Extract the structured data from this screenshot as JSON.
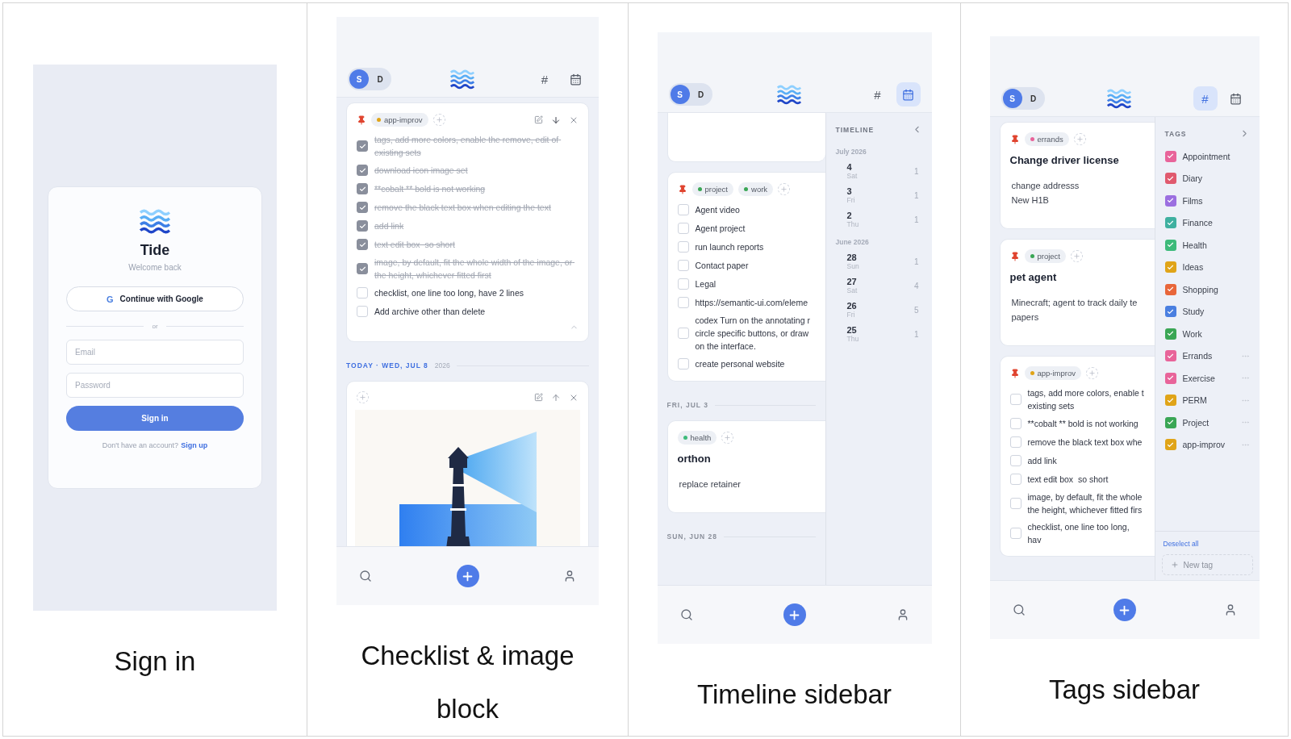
{
  "columns": [
    {
      "caption": "Sign in",
      "screen": {
        "kind": "signin",
        "app_name": "Tide",
        "subtitle": "Welcome back",
        "google_button": {
          "icon": "G",
          "label": "Continue with Google"
        },
        "divider": "or",
        "fields": [
          {
            "placeholder": "Email"
          },
          {
            "placeholder": "Password"
          }
        ],
        "submit": "Sign in",
        "footer": {
          "text": "Don't have an account?",
          "link": "Sign up"
        }
      }
    },
    {
      "caption": "Checklist & image block",
      "screen": {
        "kind": "feed",
        "header": {
          "workspaces": [
            {
              "label": "S",
              "selected": true
            },
            {
              "label": "D",
              "selected": false
            }
          ],
          "tags_button": {
            "label": "#",
            "selected": false
          },
          "timeline_button": {
            "selected": false
          }
        },
        "blocks": [
          {
            "kind": "card",
            "pinned": true,
            "tags": [
              {
                "label": "app-improv",
                "color": "#e0a418"
              }
            ],
            "toolbar": {
              "kind": "down"
            },
            "collapse": true,
            "items": [
              {
                "text": "tags, add more colors, enable the remove, edit of existing sets",
                "checked": true
              },
              {
                "text": "download icon image set",
                "checked": true
              },
              {
                "text": "**cobalt ** bold is not working",
                "checked": true
              },
              {
                "text": "remove the black text box when editing the text",
                "checked": true
              },
              {
                "text": "add link",
                "checked": true
              },
              {
                "text": "text edit box  so short",
                "checked": true
              },
              {
                "text": "image, by default, fit the whole width of the image, or the height, whichever fitted first",
                "checked": true
              },
              {
                "text": "checklist, one line too long, have 2 lines",
                "checked": false
              },
              {
                "text": "Add archive other than delete",
                "checked": false
              }
            ]
          },
          {
            "kind": "date",
            "label": "TODAY · WED, JUL 8",
            "year": "2026",
            "highlight": true
          },
          {
            "kind": "image_card",
            "pinned": false,
            "toolbar": {
              "kind": "up"
            }
          }
        ]
      }
    },
    {
      "caption": "Timeline sidebar",
      "screen": {
        "kind": "feed",
        "header": {
          "workspaces": [
            {
              "label": "S",
              "selected": true
            },
            {
              "label": "D",
              "selected": false
            }
          ],
          "tags_button": {
            "label": "#",
            "selected": false
          },
          "timeline_button": {
            "selected": true
          }
        },
        "blocks": [
          {
            "kind": "card"
          },
          {
            "kind": "card",
            "pinned": true,
            "tags": [
              {
                "label": "project",
                "color": "#3aa655"
              },
              {
                "label": "work",
                "color": "#3aa655"
              }
            ],
            "items": [
              {
                "text": "Agent video",
                "checked": false
              },
              {
                "text": "Agent project",
                "checked": false
              },
              {
                "text": "run launch reports",
                "checked": false
              },
              {
                "text": "Contact paper",
                "checked": false
              },
              {
                "text": "Legal",
                "checked": false
              },
              {
                "text": "https://semantic-ui.com/eleme",
                "checked": false
              },
              {
                "text": "codex Turn on the annotating r\ncircle specific buttons, or draw\non the interface.",
                "checked": false
              },
              {
                "text": "create personal website",
                "checked": false
              }
            ]
          },
          {
            "kind": "date",
            "label": "FRI, JUL 3",
            "highlight": false
          },
          {
            "kind": "card",
            "pinned": false,
            "tags": [
              {
                "label": "health",
                "color": "#3dba7a"
              }
            ],
            "title": "orthon",
            "body": [
              "replace retainer"
            ]
          },
          {
            "kind": "date",
            "label": "SUN, JUN 28",
            "highlight": false
          }
        ],
        "sidebar": {
          "kind": "timeline",
          "title": "TIMELINE",
          "groups": [
            {
              "month": "July 2026",
              "days": [
                {
                  "day": "4",
                  "weekday": "Sat",
                  "count": "1"
                },
                {
                  "day": "3",
                  "weekday": "Fri",
                  "count": "1"
                },
                {
                  "day": "2",
                  "weekday": "Thu",
                  "count": "1"
                }
              ]
            },
            {
              "month": "June 2026",
              "days": [
                {
                  "day": "28",
                  "weekday": "Sun",
                  "count": "1"
                },
                {
                  "day": "27",
                  "weekday": "Sat",
                  "count": "4"
                },
                {
                  "day": "26",
                  "weekday": "Fri",
                  "count": "5"
                },
                {
                  "day": "25",
                  "weekday": "Thu",
                  "count": "1"
                }
              ]
            }
          ]
        }
      }
    },
    {
      "caption": "Tags sidebar",
      "screen": {
        "kind": "feed",
        "header": {
          "workspaces": [
            {
              "label": "S",
              "selected": true
            },
            {
              "label": "D",
              "selected": false
            }
          ],
          "tags_button": {
            "label": "#",
            "selected": true
          },
          "timeline_button": {
            "selected": false
          }
        },
        "blocks": [
          {
            "kind": "card",
            "pinned": true,
            "tags": [
              {
                "label": "errands",
                "color": "#e8649a"
              }
            ],
            "title": "Change driver license",
            "body": [
              "change addresss",
              "New H1B"
            ]
          },
          {
            "kind": "card",
            "pinned": true,
            "tags": [
              {
                "label": "project",
                "color": "#3aa655"
              }
            ],
            "title": "pet agent",
            "body": [
              "Minecraft; agent to track daily te",
              "papers"
            ]
          },
          {
            "kind": "card",
            "pinned": true,
            "tags": [
              {
                "label": "app-improv",
                "color": "#e0a418"
              }
            ],
            "items": [
              {
                "text": "tags, add more colors, enable t\nexisting sets",
                "checked": false
              },
              {
                "text": "**cobalt ** bold is not working",
                "checked": false
              },
              {
                "text": "remove the black text box whe",
                "checked": false
              },
              {
                "text": "add link",
                "checked": false
              },
              {
                "text": "text edit box  so short",
                "checked": false
              },
              {
                "text": "image, by default, fit the whole\nthe height, whichever fitted firs",
                "checked": false
              },
              {
                "text": "checklist, one line too long, hav",
                "checked": false
              }
            ]
          }
        ],
        "sidebar": {
          "kind": "tags",
          "title": "TAGS",
          "tags": [
            {
              "label": "Appointment",
              "color": "#e8649a",
              "checked": true,
              "has_menu": false
            },
            {
              "label": "Diary",
              "color": "#e05a6e",
              "checked": true,
              "has_menu": false
            },
            {
              "label": "Films",
              "color": "#9b6fe0",
              "checked": true,
              "has_menu": false
            },
            {
              "label": "Finance",
              "color": "#3fb0a0",
              "checked": true,
              "has_menu": false
            },
            {
              "label": "Health",
              "color": "#3dba7a",
              "checked": true,
              "has_menu": false
            },
            {
              "label": "Ideas",
              "color": "#e0a418",
              "checked": true,
              "has_menu": false
            },
            {
              "label": "Shopping",
              "color": "#e8663a",
              "checked": true,
              "has_menu": false
            },
            {
              "label": "Study",
              "color": "#4a7fe0",
              "checked": true,
              "has_menu": false
            },
            {
              "label": "Work",
              "color": "#3aa655",
              "checked": true,
              "has_menu": false
            },
            {
              "label": "Errands",
              "color": "#e8649a",
              "checked": true,
              "has_menu": true
            },
            {
              "label": "Exercise",
              "color": "#e8649a",
              "checked": true,
              "has_menu": true
            },
            {
              "label": "PERM",
              "color": "#e0a418",
              "checked": true,
              "has_menu": true
            },
            {
              "label": "Project",
              "color": "#3aa655",
              "checked": true,
              "has_menu": true
            },
            {
              "label": "app-improv",
              "color": "#e0a418",
              "checked": true,
              "has_menu": true
            }
          ],
          "deselect": "Deselect all",
          "new_tag": "New tag"
        }
      }
    }
  ]
}
